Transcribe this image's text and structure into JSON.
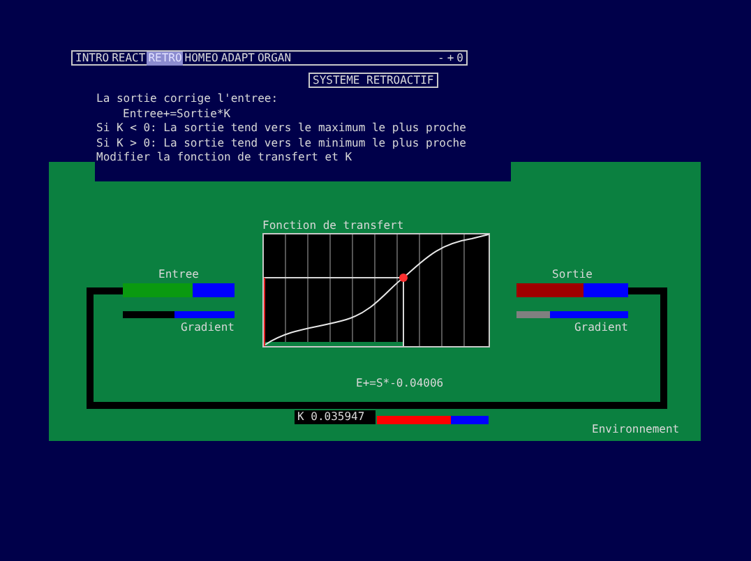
{
  "menu": {
    "tabs": [
      {
        "label": "INTRO",
        "selected": false
      },
      {
        "label": "REACT",
        "selected": false
      },
      {
        "label": "RETRO",
        "selected": true
      },
      {
        "label": "HOMEO",
        "selected": false
      },
      {
        "label": "ADAPT",
        "selected": false
      },
      {
        "label": "ORGAN",
        "selected": false
      }
    ],
    "controls": [
      "-",
      "+",
      "0"
    ]
  },
  "title": "SYSTEME RETROACTIF",
  "description": [
    {
      "text": "La sortie corrige l'entree:",
      "indented": false
    },
    {
      "text": "Entree+=Sortie*K",
      "indented": true
    },
    {
      "text": "Si K < 0: La sortie tend vers le maximum le plus proche",
      "indented": false
    },
    {
      "text": "Si K > 0: La sortie tend vers le minimum le plus proche",
      "indented": false
    },
    {
      "text": "Modifier la fonction de transfert et K",
      "indented": false
    }
  ],
  "panel": {
    "entree": {
      "label": "Entree",
      "level": 0.62
    },
    "entree_gradient": {
      "label": "Gradient",
      "level": 0.46
    },
    "chart_title": "Fonction de transfert",
    "sortie": {
      "label": "Sortie",
      "level": 0.6
    },
    "sortie_gradient": {
      "label": "Gradient",
      "level": 0.3
    },
    "equation": "E+=S*-0.04006",
    "k": {
      "label": "K 0.035947",
      "level": 0.66
    },
    "environment_label": "Environnement"
  }
}
